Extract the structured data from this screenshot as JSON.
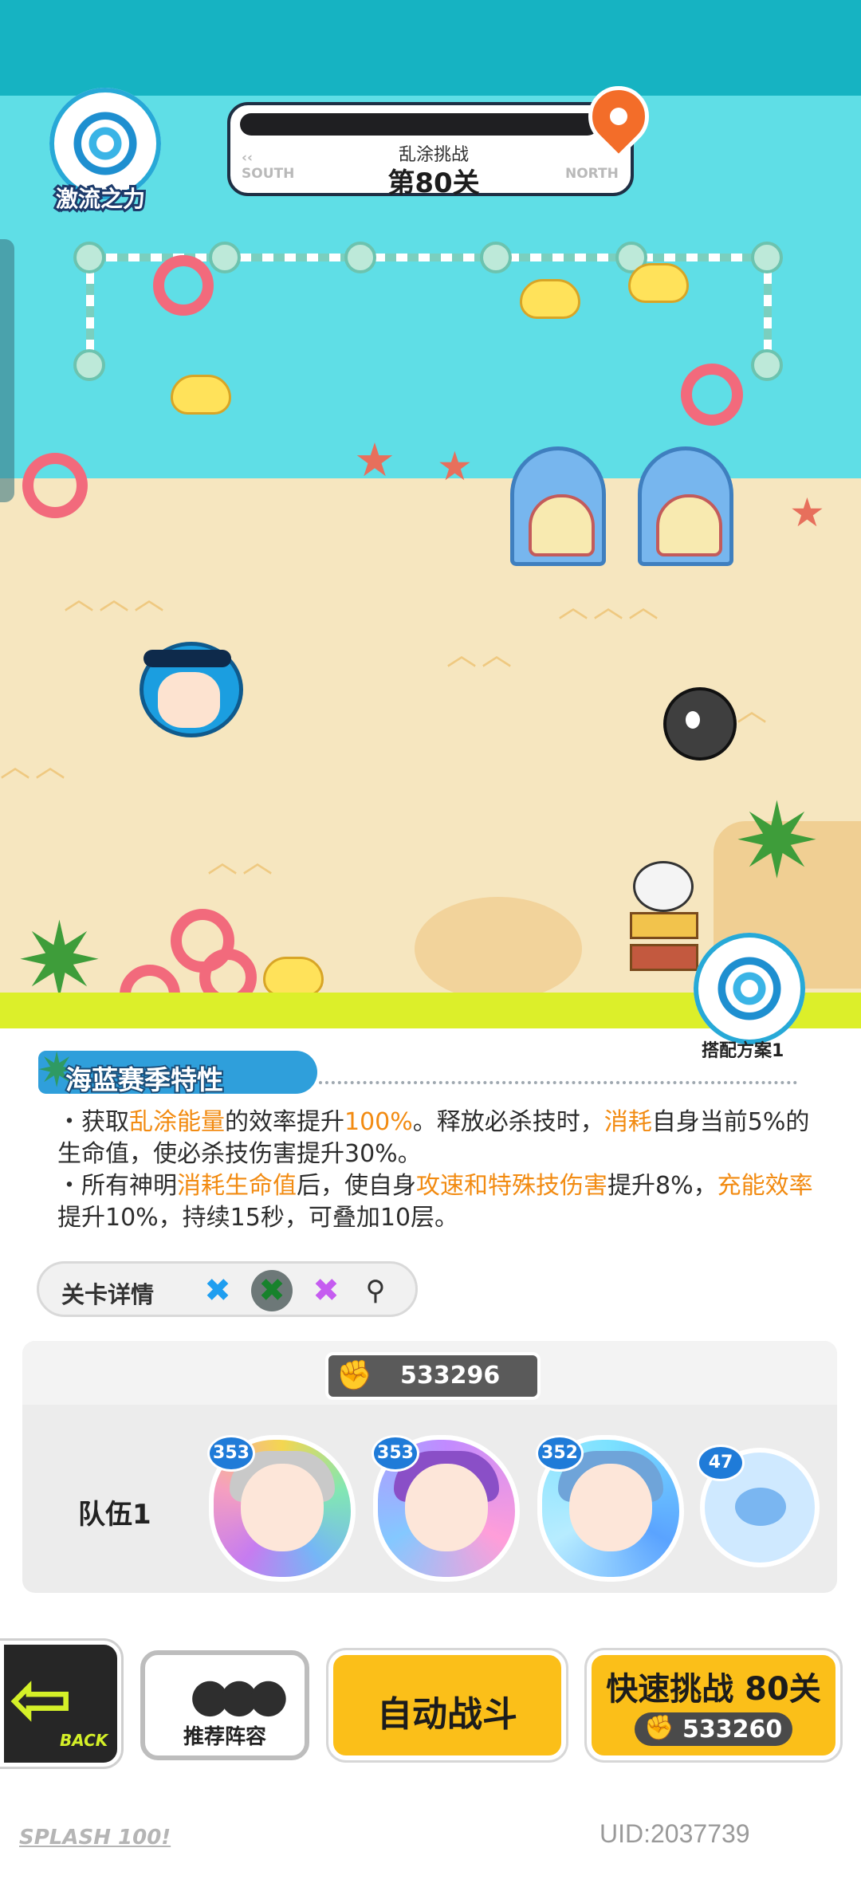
{
  "hud": {
    "power_label": "激流之力",
    "challenge_title": "乱涂挑战",
    "challenge_level": "第80关",
    "south_label": "SOUTH",
    "north_label": "NORTH",
    "settings_label": "搭配方案1"
  },
  "season": {
    "title": "海蓝赛季特性",
    "line1_parts": [
      "・获取",
      "乱涂能量",
      "的效率提升",
      "100%",
      "。释放必杀技时，",
      "消耗",
      "自身当前5%的生命值，使必杀技伤害提升30%。"
    ],
    "line2_parts": [
      "・所有神明",
      "消耗生命值",
      "后，使自身",
      "攻速和特殊技伤害",
      "提升8%，",
      "充能效率",
      "提升10%，持续15秒，可叠加10层。"
    ]
  },
  "level_detail": {
    "label": "关卡详情",
    "chips": [
      "blue-clover",
      "green-clover",
      "purple-clover",
      "magnifier"
    ]
  },
  "team": {
    "power": "533296",
    "label": "队伍1",
    "members": [
      {
        "level": "353",
        "icon": "silver-hair-hero"
      },
      {
        "level": "353",
        "icon": "purple-hair-hero"
      },
      {
        "level": "352",
        "icon": "blue-hair-crowned-hero"
      },
      {
        "level": "47",
        "icon": "blue-pet"
      }
    ]
  },
  "buttons": {
    "back": "BACK",
    "recommend": "推荐阵容",
    "auto_battle": "自动战斗",
    "quick_challenge": "快速挑战 80关",
    "quick_cost": "533260"
  },
  "footer": {
    "logo": "SPLASH 100!",
    "uid": "UID:2037739"
  },
  "colors": {
    "accent_yellow": "#fbbf19",
    "highlight_orange": "#f28b12",
    "sea": "#5fdee6",
    "sand": "#f6e6bf",
    "slime": "#dcef2a"
  }
}
